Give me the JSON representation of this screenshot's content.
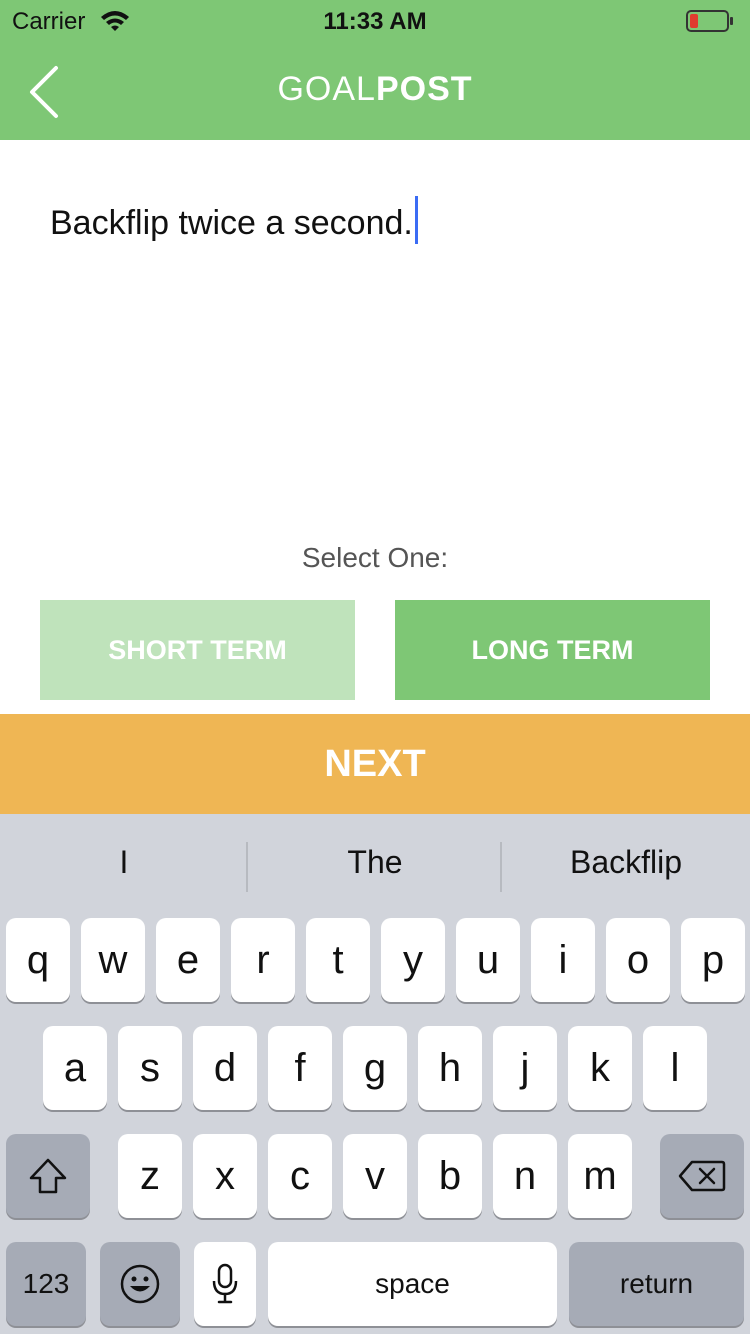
{
  "status_bar": {
    "carrier": "Carrier",
    "time": "11:33 AM"
  },
  "nav": {
    "brand_light": "GOAL",
    "brand_bold": "POST"
  },
  "goal_input": {
    "value": "Backflip twice a second."
  },
  "term_select": {
    "label": "Select One:",
    "short_label": "SHORT TERM",
    "long_label": "LONG TERM"
  },
  "next_label": "NEXT",
  "keyboard": {
    "suggestions": [
      "I",
      "The",
      "Backflip"
    ],
    "row1": [
      "q",
      "w",
      "e",
      "r",
      "t",
      "y",
      "u",
      "i",
      "o",
      "p"
    ],
    "row2": [
      "a",
      "s",
      "d",
      "f",
      "g",
      "h",
      "j",
      "k",
      "l"
    ],
    "row3": [
      "z",
      "x",
      "c",
      "v",
      "b",
      "n",
      "m"
    ],
    "numbers_label": "123",
    "space_label": "space",
    "return_label": "return"
  },
  "colors": {
    "header": "#7ec775",
    "short_term_bg": "#bfe3bb",
    "long_term_bg": "#7ec775",
    "next_bg": "#efb654",
    "caret": "#3b6cf4"
  }
}
